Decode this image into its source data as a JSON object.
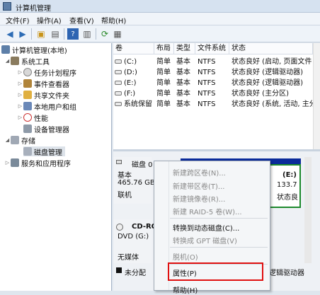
{
  "window": {
    "title": "计算机管理"
  },
  "menubar": [
    "文件(F)",
    "操作(A)",
    "查看(V)",
    "帮助(H)"
  ],
  "toolbar": {
    "icons": [
      "back-icon",
      "forward-icon",
      "up-folder-icon",
      "show-hide-tree-icon",
      "help-icon",
      "properties-icon",
      "refresh-icon",
      "export-icon"
    ]
  },
  "tree": {
    "root": "计算机管理(本地)",
    "system_tools": "系统工具",
    "items": [
      "任务计划程序",
      "事件查看器",
      "共享文件夹",
      "本地用户和组",
      "性能",
      "设备管理器"
    ],
    "storage": "存储",
    "disk_mgmt": "磁盘管理",
    "services": "服务和应用程序"
  },
  "table": {
    "headers": [
      "卷",
      "布局",
      "类型",
      "文件系统",
      "状态"
    ],
    "rows": [
      [
        "(C:)",
        "简单",
        "基本",
        "NTFS",
        "状态良好 (启动, 页面文件"
      ],
      [
        "(D:)",
        "简单",
        "基本",
        "NTFS",
        "状态良好 (逻辑驱动器)"
      ],
      [
        "(E:)",
        "简单",
        "基本",
        "NTFS",
        "状态良好 (逻辑驱动器)"
      ],
      [
        "(F:)",
        "简单",
        "基本",
        "NTFS",
        "状态良好 (主分区)"
      ],
      [
        "系统保留",
        "简单",
        "基本",
        "NTFS",
        "状态良好 (系统, 活动, 主分"
      ]
    ]
  },
  "disk0": {
    "name": "磁盘 0",
    "type": "基本",
    "size": "465.76 GB",
    "status": "联机"
  },
  "partition_e": {
    "name": "(E:)",
    "size": "133.7",
    "status": "状态良"
  },
  "cdrom": {
    "name": "CD-RO",
    "type": "DVD (G:)",
    "media": "无媒体"
  },
  "legend": {
    "unallocated": "未分配",
    "logical": "逻辑驱动器"
  },
  "context_menu": {
    "items": [
      "新建跨区卷(N)...",
      "新建带区卷(T)...",
      "新建镜像卷(R)...",
      "新建 RAID-5 卷(W)...",
      "转换到动态磁盘(C)...",
      "转换成 GPT 磁盘(V)",
      "脱机(O)",
      "属性(P)",
      "帮助(H)"
    ]
  },
  "colors": {
    "accent_border": "#e01010",
    "partition_border": "#1d8a2d",
    "bar_blue": "#0a0aa0"
  }
}
